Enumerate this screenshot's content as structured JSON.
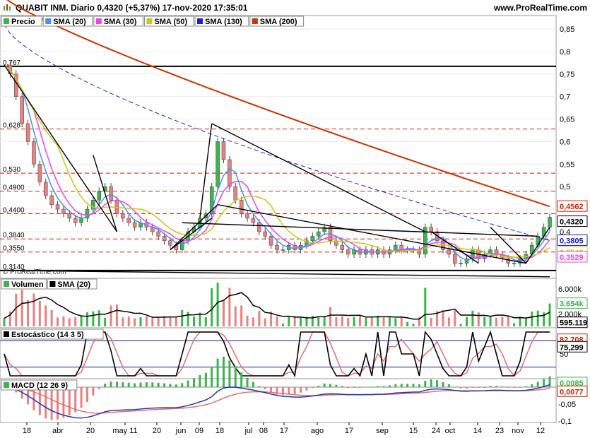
{
  "header": {
    "title": "QUABIT INM. Diario 0,4320 (+5,37%) 17-nov-2020 17:35:01",
    "site": "www.ProRealTime.com"
  },
  "watermark": "© ProRealTime.com",
  "price_panel": {
    "legend": [
      {
        "label": "Precio",
        "color": "#3cb44b",
        "kind": "candle"
      },
      {
        "label": "SMA (20)",
        "color": "#4a8ff0"
      },
      {
        "label": "SMA (30)",
        "color": "#ee44ee"
      },
      {
        "label": "SMA (50)",
        "color": "#c8c818"
      },
      {
        "label": "SMA (130)",
        "color": "#2222cc"
      },
      {
        "label": "SMA (200)",
        "color": "#cc3300"
      }
    ],
    "yticks": [
      "0,85",
      "0,8",
      "0,75",
      "0,7",
      "0,65",
      "0,6",
      "0,55",
      "0,5",
      "0,4"
    ],
    "level_labels": [
      "0,767",
      "0,628",
      "0,530",
      "0,4900",
      "0,4400",
      "0,3840",
      "0,3550",
      "0,3140"
    ],
    "value_badges": [
      {
        "text": "0,4562",
        "color": "#cc2200"
      },
      {
        "text": "0,4320",
        "color": "#000000"
      },
      {
        "text": "0,3805",
        "color": "#1a1acc"
      },
      {
        "text": "0,3543",
        "color": "#c8c818"
      },
      {
        "text": "0,3529",
        "color": "#ee44ee"
      }
    ]
  },
  "volume_panel": {
    "legend": [
      {
        "label": "Volumen",
        "color": "#3cb44b"
      },
      {
        "label": "SMA (20)",
        "color": "#000000"
      }
    ],
    "yticks": [
      "6.000k",
      "2.000k"
    ],
    "value_badges": [
      {
        "text": "3.654k",
        "color": "#3cb44b"
      },
      {
        "text": "595.119",
        "color": "#000000"
      }
    ]
  },
  "stoch_panel": {
    "legend": [
      {
        "label": "Estocástico (14 3 5)",
        "color": "#000000"
      }
    ],
    "yticks": [
      "50"
    ],
    "value_badges": [
      {
        "text": "82,708",
        "color": "#cc2200"
      },
      {
        "text": "75,299",
        "color": "#000000"
      }
    ]
  },
  "macd_panel": {
    "legend": [
      {
        "label": "MACD (12 26 9)",
        "color": "#3cb44b"
      }
    ],
    "yticks": [
      "-0,05",
      "-0,1"
    ],
    "value_badges": [
      {
        "text": "0,0085",
        "color": "#3cb44b"
      },
      {
        "text": "0,0077",
        "color": "#cc2200"
      }
    ]
  },
  "xaxis": [
    "18",
    "abr",
    "20",
    "may 11",
    "20",
    "jun",
    "09",
    "18",
    "jul",
    "08",
    "17",
    "ago",
    "17",
    "sep",
    "15",
    "24",
    "oct",
    "14",
    "23",
    "nov",
    "12"
  ],
  "chart_data": {
    "type": "candlestick",
    "title": "QUABIT INM. Diario",
    "last_price": 0.432,
    "change_pct": 5.37,
    "date": "17-nov-2020",
    "close_series": [
      0.77,
      0.75,
      0.7,
      0.64,
      0.6,
      0.55,
      0.51,
      0.48,
      0.46,
      0.45,
      0.44,
      0.43,
      0.42,
      0.43,
      0.45,
      0.47,
      0.49,
      0.5,
      0.47,
      0.44,
      0.43,
      0.42,
      0.41,
      0.42,
      0.41,
      0.4,
      0.39,
      0.38,
      0.37,
      0.36,
      0.38,
      0.4,
      0.41,
      0.43,
      0.44,
      0.5,
      0.6,
      0.56,
      0.5,
      0.47,
      0.44,
      0.43,
      0.42,
      0.4,
      0.39,
      0.37,
      0.36,
      0.36,
      0.37,
      0.36,
      0.37,
      0.38,
      0.39,
      0.4,
      0.41,
      0.38,
      0.37,
      0.36,
      0.35,
      0.36,
      0.35,
      0.36,
      0.35,
      0.36,
      0.35,
      0.36,
      0.37,
      0.36,
      0.36,
      0.36,
      0.35,
      0.41,
      0.4,
      0.38,
      0.36,
      0.35,
      0.33,
      0.33,
      0.34,
      0.36,
      0.34,
      0.35,
      0.36,
      0.35,
      0.34,
      0.33,
      0.33,
      0.34,
      0.35,
      0.37,
      0.39,
      0.41,
      0.432
    ],
    "sma200_end": 0.4562,
    "sma130_end": 0.3805,
    "sma50_end": 0.3543,
    "sma30_end": 0.3529,
    "volume_last_k": 3654,
    "volume_sma20": 595119,
    "stoch_k": 82.708,
    "stoch_d": 75.299,
    "macd": 0.0085,
    "macd_signal": 0.0077
  }
}
